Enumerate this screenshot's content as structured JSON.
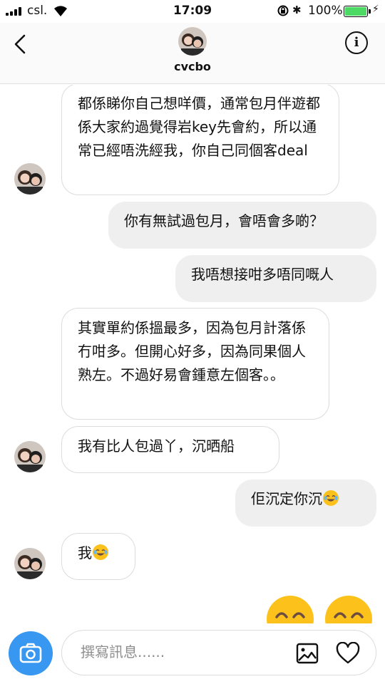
{
  "status_bar": {
    "carrier": "csl.",
    "time": "17:09",
    "battery": "100%",
    "bluetooth": "✱",
    "charge": "⚡",
    "battery_level": 1.0
  },
  "header": {
    "username": "cvcbo",
    "info_label": "i"
  },
  "messages": [
    {
      "side": "in",
      "text": "都係睇你自己想咩價，通常包月伴遊都係大家約過覺得岩key先會約，所以通常已經唔洗經我，你自己同個客deal"
    },
    {
      "side": "out",
      "text": "你有無試過包月，會唔會多啲？"
    },
    {
      "side": "out",
      "text": "我唔想接咁多唔同嘅人"
    },
    {
      "side": "in",
      "text": "其實單約係搵最多，因為包月計落係冇咁多。但開心好多，因為同果個人熟左。不過好易會鍾意左個客。。"
    },
    {
      "side": "in",
      "text": "我有比人包過丫，沉晒船"
    },
    {
      "side": "out",
      "text": "佢沉定你沉",
      "emoji": "joy-emoji"
    },
    {
      "side": "in",
      "text": "我",
      "emoji": "joy-emoji"
    }
  ],
  "composer": {
    "placeholder": "撰寫訊息......"
  },
  "colors": {
    "accent": "#3897f0",
    "outgoing_bubble": "#efefef",
    "incoming_border": "#dcdcdc",
    "battery_green": "#4cd964",
    "emoji_yellow": "#fcc21b"
  }
}
